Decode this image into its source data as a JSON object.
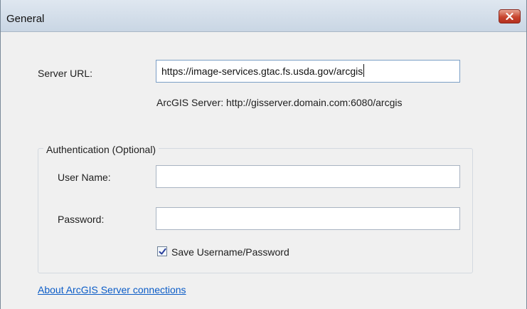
{
  "window": {
    "title": "General",
    "close_icon": "close-x-icon"
  },
  "server": {
    "label": "Server URL:",
    "url_value": "https://image-services.gtac.fs.usda.gov/arcgis",
    "example_hint": "ArcGIS Server: http://gisserver.domain.com:6080/arcgis"
  },
  "auth": {
    "group_label": "Authentication (Optional)",
    "username_label": "User Name:",
    "username_value": "",
    "password_label": "Password:",
    "password_value": "",
    "save_label": "Save Username/Password",
    "save_checked": true
  },
  "footer": {
    "help_link": "About ArcGIS Server connections"
  },
  "colors": {
    "link": "#0b5cc7",
    "close_button": "#c8452f"
  }
}
